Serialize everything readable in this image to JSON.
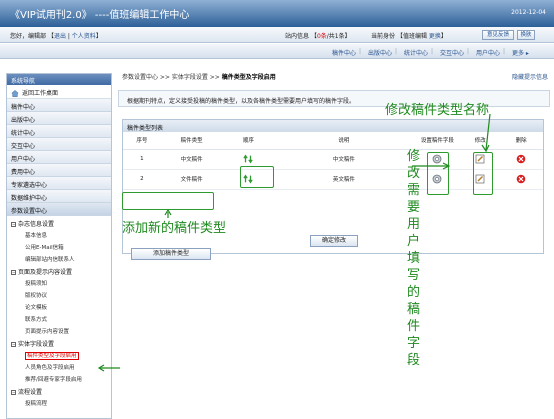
{
  "header": {
    "app_title": "《VIP试用刊2.0》 ----值班编辑工作中心",
    "date": "2012-12-04"
  },
  "userbar": {
    "greeting": "您好，编辑部",
    "logout": "退出",
    "profile": "个人资料",
    "messages_label": "站内信息",
    "messages_count": "0条",
    "messages_total": "/共1条",
    "role_label": "当前身份",
    "role_value": "值班编辑",
    "change_role": "更换",
    "feedback_btn": "意见反馈",
    "switch_btn": "换肤"
  },
  "nav": {
    "items": [
      "稿件中心",
      "出版中心",
      "统计中心",
      "交互中心",
      "用户中心",
      "更多"
    ]
  },
  "sidebar": {
    "title": "系统导航",
    "home": "返回工作桌面",
    "items": [
      "稿件中心",
      "出版中心",
      "统计中心",
      "交互中心",
      "用户中心",
      "费用中心",
      "专家遴选中心",
      "数据维护中心",
      "参数设置中心"
    ],
    "groups": [
      {
        "title": "杂志信息设置",
        "subs": [
          "基本信息",
          "公用E-Mail信箱",
          "编辑部站内信联系人"
        ]
      },
      {
        "title": "页面及提示内容设置",
        "subs": [
          "投稿须知",
          "版权协议",
          "论文模板",
          "联系方式",
          "页面提示内容设置"
        ]
      },
      {
        "title": "实体字段设置",
        "subs": [
          "稿件类型及字段启用",
          "人员角色及字段启用",
          "推荐/回避专家字段启用"
        ]
      },
      {
        "title": "流程设置",
        "subs": [
          "投稿流程"
        ]
      }
    ]
  },
  "main": {
    "breadcrumb_prefix": "参数设置中心 >> 实体字段设置 >> ",
    "breadcrumb_current": "稿件类型及字段启用",
    "hide_tip": "隐藏提示信息",
    "description": "根据期刊特点，定义接受投稿的稿件类型，以及各稿件类型需要用户填写的稿件字段。",
    "panel_title": "稿件类型列表",
    "table_headers": [
      "序号",
      "稿件类型",
      "顺序",
      "说明",
      "设置稿件字段",
      "修改",
      "删除"
    ],
    "rows": [
      {
        "no": "1",
        "type": "中文稿件",
        "desc": "中文稿件"
      },
      {
        "no": "2",
        "type": "文件稿件",
        "desc": "英文稿件"
      }
    ],
    "add_button": "添加稿件类型",
    "confirm_button": "确定修改"
  },
  "annotations": {
    "rename": "修改稿件类型名称",
    "add": "添加新的稿件类型",
    "fields": "修改需要用户填写的稿件字段"
  },
  "colors": {
    "header_blue": "#2d5f98",
    "annotation_green": "#1f8a1f",
    "highlight_red": "#dd0000"
  }
}
